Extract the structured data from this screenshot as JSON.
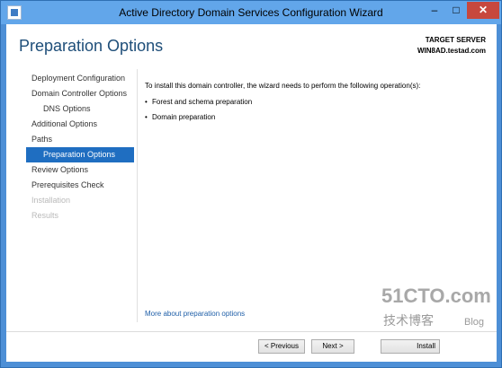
{
  "window": {
    "title": "Active Directory Domain Services Configuration Wizard",
    "controls": {
      "minimize": "–",
      "maximize": "□",
      "close": "✕"
    }
  },
  "header": {
    "title": "Preparation Options",
    "target_label": "TARGET SERVER",
    "target_host": "WIN8AD.testad.com"
  },
  "nav": {
    "items": [
      {
        "label": "Deployment Configuration",
        "state": "normal"
      },
      {
        "label": "Domain Controller Options",
        "state": "normal"
      },
      {
        "label": "DNS Options",
        "state": "normal"
      },
      {
        "label": "Additional Options",
        "state": "normal"
      },
      {
        "label": "Paths",
        "state": "normal"
      },
      {
        "label": "Preparation Options",
        "state": "active"
      },
      {
        "label": "Review Options",
        "state": "normal"
      },
      {
        "label": "Prerequisites Check",
        "state": "normal"
      },
      {
        "label": "Installation",
        "state": "disabled"
      },
      {
        "label": "Results",
        "state": "disabled"
      }
    ]
  },
  "content": {
    "intro": "To install this domain controller, the wizard needs to perform the following operation(s):",
    "bullets": [
      "Forest and schema preparation",
      "Domain preparation"
    ],
    "more_link": "More about preparation options"
  },
  "footer": {
    "prev_label": "< Previous",
    "next_label": "Next >",
    "install_label": "Install"
  },
  "watermark": {
    "main": "51CTO.com",
    "cn": "技术博客",
    "blog": "Blog"
  },
  "colors": {
    "titlebar": "#62a6ea",
    "accent": "#1f6ec1",
    "title_text": "#1e4e79",
    "close_button": "#c7483e"
  }
}
